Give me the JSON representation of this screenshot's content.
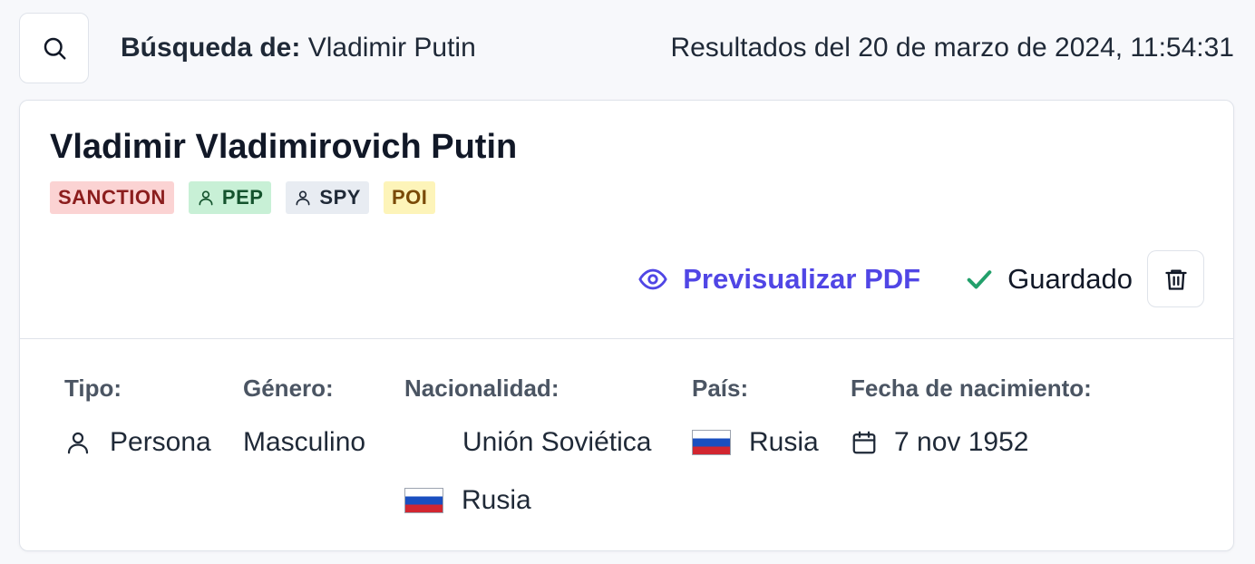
{
  "header": {
    "search_label_prefix": "Búsqueda de:",
    "search_query": "Vladimir Putin",
    "results_timestamp": "Resultados del 20 de marzo de 2024, 11:54:31"
  },
  "profile": {
    "name": "Vladimir Vladimirovich Putin",
    "badges": [
      {
        "label": "SANCTION",
        "icon": null
      },
      {
        "label": "PEP",
        "icon": "person-icon"
      },
      {
        "label": "SPY",
        "icon": "person-icon"
      },
      {
        "label": "POI",
        "icon": null
      }
    ]
  },
  "actions": {
    "preview_label": "Previsualizar PDF",
    "saved_label": "Guardado"
  },
  "details": {
    "type_label": "Tipo:",
    "type_value": "Persona",
    "gender_label": "Género:",
    "gender_value": "Masculino",
    "nationality_label": "Nacionalidad:",
    "nationality_values": [
      "Unión Soviética",
      "Rusia"
    ],
    "country_label": "País:",
    "country_value": "Rusia",
    "dob_label": "Fecha de nacimiento:",
    "dob_value": "7 nov 1952"
  },
  "colors": {
    "accent": "#5046e5",
    "saved_check": "#22a06b",
    "sanction_bg": "#fbd3d3",
    "pep_bg": "#c8f0d6",
    "spy_bg": "#e8ecf2",
    "poi_bg": "#fdf4b9"
  }
}
